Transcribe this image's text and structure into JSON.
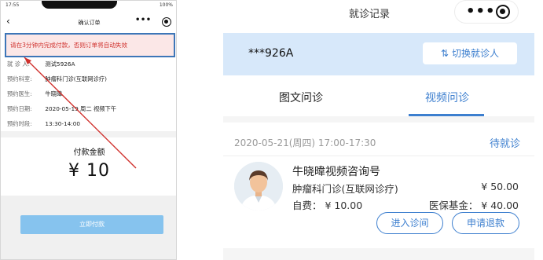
{
  "left_screen": {
    "status": {
      "time": "17:55",
      "battery": "100%"
    },
    "nav": {
      "back_icon": "‹",
      "title": "确认订单"
    },
    "warning": "请在3分钟内完成付款，否则订单将自动失效",
    "info_rows": [
      {
        "label": "就  诊  人:",
        "value": "测试5926A"
      },
      {
        "label": "预约科室:",
        "value": "肿瘤科门诊(互联网诊疗)"
      },
      {
        "label": "预约医生:",
        "value": "牛晓暐"
      },
      {
        "label": "预约日期:",
        "value": "2020-05-19 周二 视频下午"
      },
      {
        "label": "预约时段:",
        "value": "13:30-14:00"
      }
    ],
    "pay_label": "付款金额",
    "pay_amount": "¥ 10",
    "pay_button": "立即付款",
    "annotation_color": "#d0312d"
  },
  "right_screen": {
    "title": "就诊记录",
    "patient_name": "***926A",
    "switch_button": "切换就诊人",
    "tabs": [
      {
        "label": "图文问诊",
        "active": false
      },
      {
        "label": "视频问诊",
        "active": true
      }
    ],
    "record": {
      "date": "2020-05-21(周四)  17:00-17:30",
      "status": "待就诊",
      "title": "牛晓暐视频咨询号",
      "department": "肿瘤科门诊(互联网诊疗)",
      "price": "¥ 50.00",
      "self_pay": "自费：  ¥ 10.00",
      "insurance": "医保基金：  ¥ 40.00",
      "enter_button": "进入诊间",
      "refund_button": "申请退款"
    },
    "accent_color": "#3d7fcf"
  }
}
